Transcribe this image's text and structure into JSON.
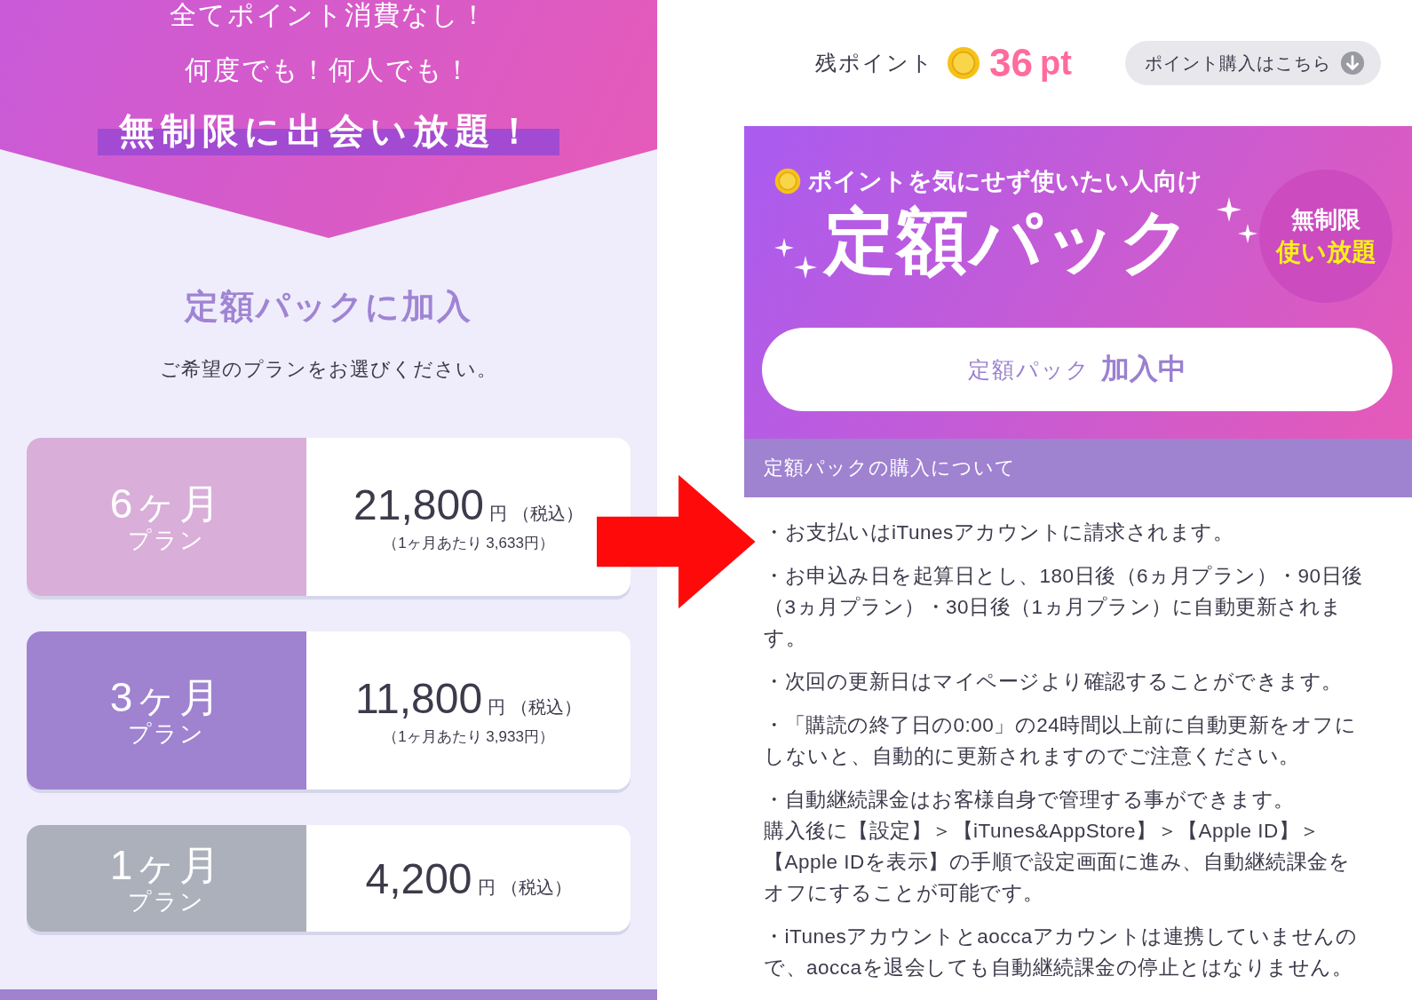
{
  "left": {
    "header_lines": [
      "全てポイント消費なし！",
      "何度でも！何人でも！"
    ],
    "highlight": "無制限に出会い放題！",
    "title": "定額パックに加入",
    "subtitle": "ご希望のプランをお選びください。",
    "plans": [
      {
        "duration": "6ヶ月",
        "label": "プラン",
        "price": "21,800",
        "unit": "円",
        "tax": "（税込）",
        "per_month": "（1ヶ月あたり 3,633円）",
        "color": "#d9aed9"
      },
      {
        "duration": "3ヶ月",
        "label": "プラン",
        "price": "11,800",
        "unit": "円",
        "tax": "（税込）",
        "per_month": "（1ヶ月あたり 3,933円）",
        "color": "#9f82d0"
      },
      {
        "duration": "1ヶ月",
        "label": "プラン",
        "price": "4,200",
        "unit": "円",
        "tax": "（税込）",
        "color": "#abb0bb"
      }
    ]
  },
  "right": {
    "points_label": "残ポイント",
    "points_value": "36",
    "points_unit": "pt",
    "buy_button": "ポイント購入はこちら",
    "banner": {
      "tagline": "ポイントを気にせず使いたい人向け",
      "title": "定額パック",
      "badge_line1": "無制限",
      "badge_line2": "使い放題",
      "status_prefix": "定額パック",
      "status": "加入中"
    },
    "section_title": "定額パックの購入について",
    "notes": [
      "・お支払いはiTunesアカウントに請求されます。",
      "・お申込み日を起算日とし、180日後（6ヵ月プラン）・90日後（3ヵ月プラン）・30日後（1ヵ月プラン）に自動更新されます。",
      "・次回の更新日はマイページより確認することができます。",
      "・「購読の終了日の0:00」の24時間以上前に自動更新をオフにしないと、自動的に更新されますのでご注意ください。",
      [
        "・自動継続課金はお客様自身で管理する事ができます。",
        "購入後に【設定】＞【iTunes&AppStore】＞【Apple ID】＞【Apple IDを表示】の手順で設定画面に進み、自動継続課金をオフにすることが可能です。"
      ],
      "・iTunesアカウントとaoccaアカウントは連携していませんので、aoccaを退会しても自動継続課金の停止とはなりません。"
    ]
  }
}
